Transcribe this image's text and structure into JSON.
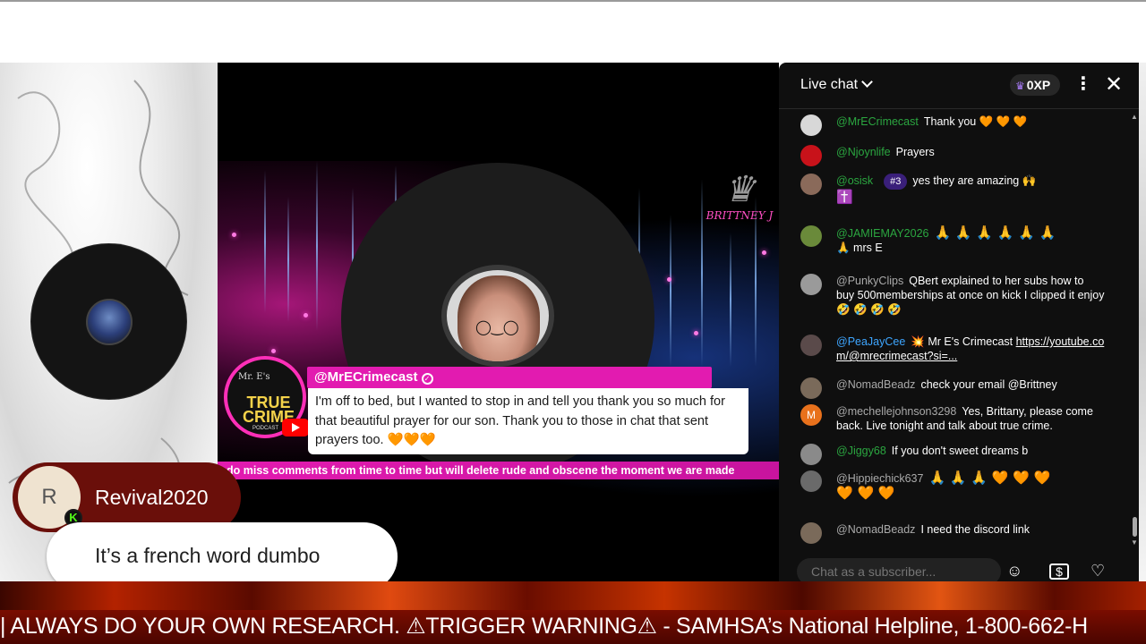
{
  "ticker": {
    "text": "| ALWAYS DO YOUR OWN RESEARCH. ⚠TRIGGER WARNING⚠ - SAMHSA’s National Helpline, 1-800-662-H"
  },
  "stream": {
    "brand_text": "BRITTNEY J",
    "podcast_logo_top": "Mr. E's",
    "podcast_logo_main": "TRUE CRIME",
    "podcast_logo_sub": "PODCAST",
    "featured_comment": {
      "author": "@MrECrimecast",
      "text": "I'm off to bed, but I wanted to stop in and tell you thank you so much for that beautiful prayer for our son. Thank you to those in chat that sent prayers too. 🧡🧡🧡"
    },
    "scroll_text": "do miss comments from time to time but will delete rude and obscene the moment we are made"
  },
  "overlay": {
    "user_initial": "R",
    "platform_badge": "K",
    "username": "Revival2020",
    "message": "It’s a french word dumbo"
  },
  "chat": {
    "title": "Live chat",
    "xp_label": "0XP",
    "input_placeholder": "Chat as a subscriber...",
    "messages": [
      {
        "author": "@MrECrimecast",
        "text": "Thank you 🧡 🧡 🧡"
      },
      {
        "author": "@Njoynlife",
        "text": "Prayers"
      },
      {
        "author": "@osisk",
        "badge": "#3",
        "text": "yes they are amazing 🙌",
        "extra": "✝️"
      },
      {
        "author": "@JAMIEMAY2026",
        "text": "🙏 🙏 🙏 🙏 🙏 🙏",
        "extra": "🙏 mrs E"
      },
      {
        "author": "@PunkyClips",
        "text": "QBert explained to her subs how to buy 500memberships at once on kick I clipped it enjoy 🤣 🤣 🤣 🤣"
      },
      {
        "author": "@PeaJayCee",
        "text": "💥 Mr E's Crimecast",
        "link": "https://youtube.com/@mrecrimecast?si=..."
      },
      {
        "author": "@NomadBeadz",
        "text": "check your email @Brittney"
      },
      {
        "author": "@mechellejohnson3298",
        "text": "Yes, Brittany, please come back. Live tonight and talk about true crime."
      },
      {
        "author": "@Jiggy68",
        "text": "If you don't sweet dreams b"
      },
      {
        "author": "@Hippiechick637",
        "text": "🙏 🙏 🙏 🧡 🧡 🧡",
        "extra": "🧡 🧡 🧡"
      },
      {
        "author": "@NomadBeadz",
        "text": "I need the discord link"
      }
    ]
  },
  "colors": {
    "member_name": "#2ba640",
    "mod_name": "#3ea6ff",
    "accent_pink": "#e21bb0",
    "chat_bg": "#0f0f0f"
  }
}
